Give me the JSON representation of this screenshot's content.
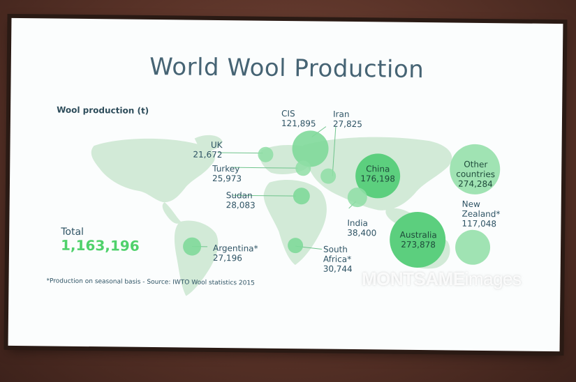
{
  "slide": {
    "title": "World Wool Production",
    "subtitle": "Wool production (t)",
    "total_label": "Total",
    "total_value": "1,163,196",
    "footnote": "*Production on seasonal basis - Source: IWTO Wool statistics 2015"
  },
  "regions": [
    {
      "key": "cis",
      "name": "CIS",
      "value": "121,895"
    },
    {
      "key": "iran",
      "name": "Iran",
      "value": "27,825"
    },
    {
      "key": "uk",
      "name": "UK",
      "value": "21,672"
    },
    {
      "key": "turkey",
      "name": "Turkey",
      "value": "25,973"
    },
    {
      "key": "sudan",
      "name": "Sudan",
      "value": "28,083"
    },
    {
      "key": "china",
      "name": "China",
      "value": "176,198"
    },
    {
      "key": "other",
      "name_line1": "Other",
      "name_line2": "countries",
      "value": "274,284"
    },
    {
      "key": "india",
      "name": "India",
      "value": "38,400"
    },
    {
      "key": "nz",
      "name_line1": "New",
      "name_line2": "Zealand*",
      "value": "117,048"
    },
    {
      "key": "australia",
      "name": "Australia",
      "value": "273,878"
    },
    {
      "key": "argentina",
      "name": "Argentina*",
      "value": "27,196"
    },
    {
      "key": "southafrica",
      "name_line1": "South",
      "name_line2": "Africa*",
      "value": "30,744"
    }
  ],
  "watermark": {
    "bold": "MONTSAME",
    "light": "images"
  },
  "colors": {
    "map": "#cfe8d4",
    "bubble": "#8fdea6",
    "bubble_strong": "#5ccf7e",
    "text": "#2e5364",
    "total": "#4fd16b"
  }
}
